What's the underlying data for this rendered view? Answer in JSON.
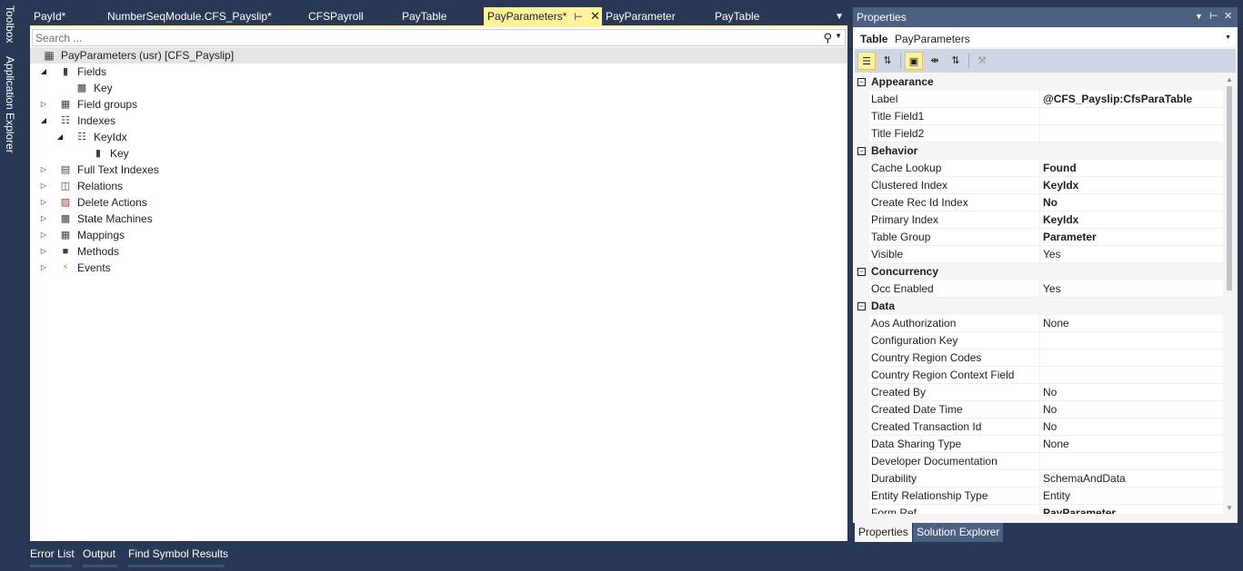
{
  "side_tabs": [
    "Toolbox",
    "Application Explorer"
  ],
  "doc_tabs": [
    {
      "label": "PayId*"
    },
    {
      "label": "NumberSeqModule.CFS_Payslip*"
    },
    {
      "label": "CFSPayroll"
    },
    {
      "label": "PayTable"
    },
    {
      "label": "PayParameters*",
      "active": true
    },
    {
      "label": "PayParameter"
    },
    {
      "label": "PayTable"
    }
  ],
  "search": {
    "placeholder": "Search ..."
  },
  "tree": {
    "root": "PayParameters (usr) [CFS_Payslip]",
    "nodes": [
      {
        "label": "Fields",
        "state": "expanded",
        "level": 1,
        "icon": "field-icon"
      },
      {
        "label": "Key",
        "state": "none",
        "level": 2,
        "icon": "field-key-icon"
      },
      {
        "label": "Field groups",
        "state": "collapsed",
        "level": 1,
        "icon": "field-group-icon"
      },
      {
        "label": "Indexes",
        "state": "expanded",
        "level": 1,
        "icon": "index-icon"
      },
      {
        "label": "KeyIdx",
        "state": "expanded",
        "level": 2,
        "icon": "index-icon"
      },
      {
        "label": "Key",
        "state": "none",
        "level": 3,
        "icon": "field-icon"
      },
      {
        "label": "Full Text Indexes",
        "state": "collapsed",
        "level": 1,
        "icon": "full-text-index-icon"
      },
      {
        "label": "Relations",
        "state": "collapsed",
        "level": 1,
        "icon": "relation-icon"
      },
      {
        "label": "Delete Actions",
        "state": "collapsed",
        "level": 1,
        "icon": "delete-action-icon"
      },
      {
        "label": "State Machines",
        "state": "collapsed",
        "level": 1,
        "icon": "state-machine-icon"
      },
      {
        "label": "Mappings",
        "state": "collapsed",
        "level": 1,
        "icon": "mapping-icon"
      },
      {
        "label": "Methods",
        "state": "collapsed",
        "level": 1,
        "icon": "method-icon"
      },
      {
        "label": "Events",
        "state": "collapsed",
        "level": 1,
        "icon": "event-icon"
      }
    ]
  },
  "bottom_tabs": [
    "Error List",
    "Output",
    "Find Symbol Results"
  ],
  "properties": {
    "title": "Properties",
    "object_kind": "Table",
    "object_name": "PayParameters",
    "categories": [
      {
        "name": "Appearance",
        "rows": [
          {
            "name": "Label",
            "value": "@CFS_Payslip:CfsParaTable",
            "bold": true
          },
          {
            "name": "Title Field1",
            "value": ""
          },
          {
            "name": "Title Field2",
            "value": ""
          }
        ]
      },
      {
        "name": "Behavior",
        "rows": [
          {
            "name": "Cache Lookup",
            "value": "Found",
            "bold": true
          },
          {
            "name": "Clustered Index",
            "value": "KeyIdx",
            "bold": true
          },
          {
            "name": "Create Rec Id Index",
            "value": "No",
            "bold": true
          },
          {
            "name": "Primary Index",
            "value": "KeyIdx",
            "bold": true
          },
          {
            "name": "Table Group",
            "value": "Parameter",
            "bold": true
          },
          {
            "name": "Visible",
            "value": "Yes"
          }
        ]
      },
      {
        "name": "Concurrency",
        "rows": [
          {
            "name": "Occ Enabled",
            "value": "Yes"
          }
        ]
      },
      {
        "name": "Data",
        "rows": [
          {
            "name": "Aos Authorization",
            "value": "None"
          },
          {
            "name": "Configuration Key",
            "value": ""
          },
          {
            "name": "Country Region Codes",
            "value": ""
          },
          {
            "name": "Country Region Context Field",
            "value": ""
          },
          {
            "name": "Created By",
            "value": "No"
          },
          {
            "name": "Created Date Time",
            "value": "No"
          },
          {
            "name": "Created Transaction Id",
            "value": "No"
          },
          {
            "name": "Data Sharing Type",
            "value": "None"
          },
          {
            "name": "Developer Documentation",
            "value": ""
          },
          {
            "name": "Durability",
            "value": "SchemaAndData"
          },
          {
            "name": "Entity Relationship Type",
            "value": "Entity"
          },
          {
            "name": "Form Ref",
            "value": "PayParameter",
            "bold": true
          }
        ]
      }
    ],
    "tabs": [
      {
        "label": "Properties",
        "active": true
      },
      {
        "label": "Solution Explorer",
        "active": false
      }
    ]
  },
  "colors": {
    "chrome": "#293955",
    "active_tab": "#fff29d",
    "panel_title": "#4d6082"
  }
}
